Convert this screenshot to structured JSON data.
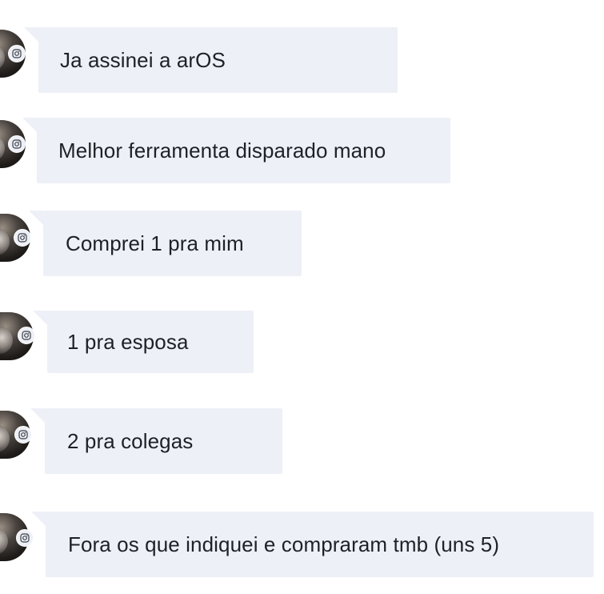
{
  "conversation": {
    "messages": [
      {
        "text": "Ja assinei a arOS"
      },
      {
        "text": "Melhor ferramenta disparado mano"
      },
      {
        "text": "Comprei 1 pra mim"
      },
      {
        "text": "1 pra esposa"
      },
      {
        "text": "2 pra colegas"
      },
      {
        "text": "Fora os que indiquei e compraram tmb (uns 5)"
      }
    ]
  },
  "colors": {
    "bubble_background": "#eef0f7",
    "text": "#1e2127",
    "page_background": "#ffffff"
  },
  "icons": {
    "platform_badge": "instagram-icon"
  }
}
